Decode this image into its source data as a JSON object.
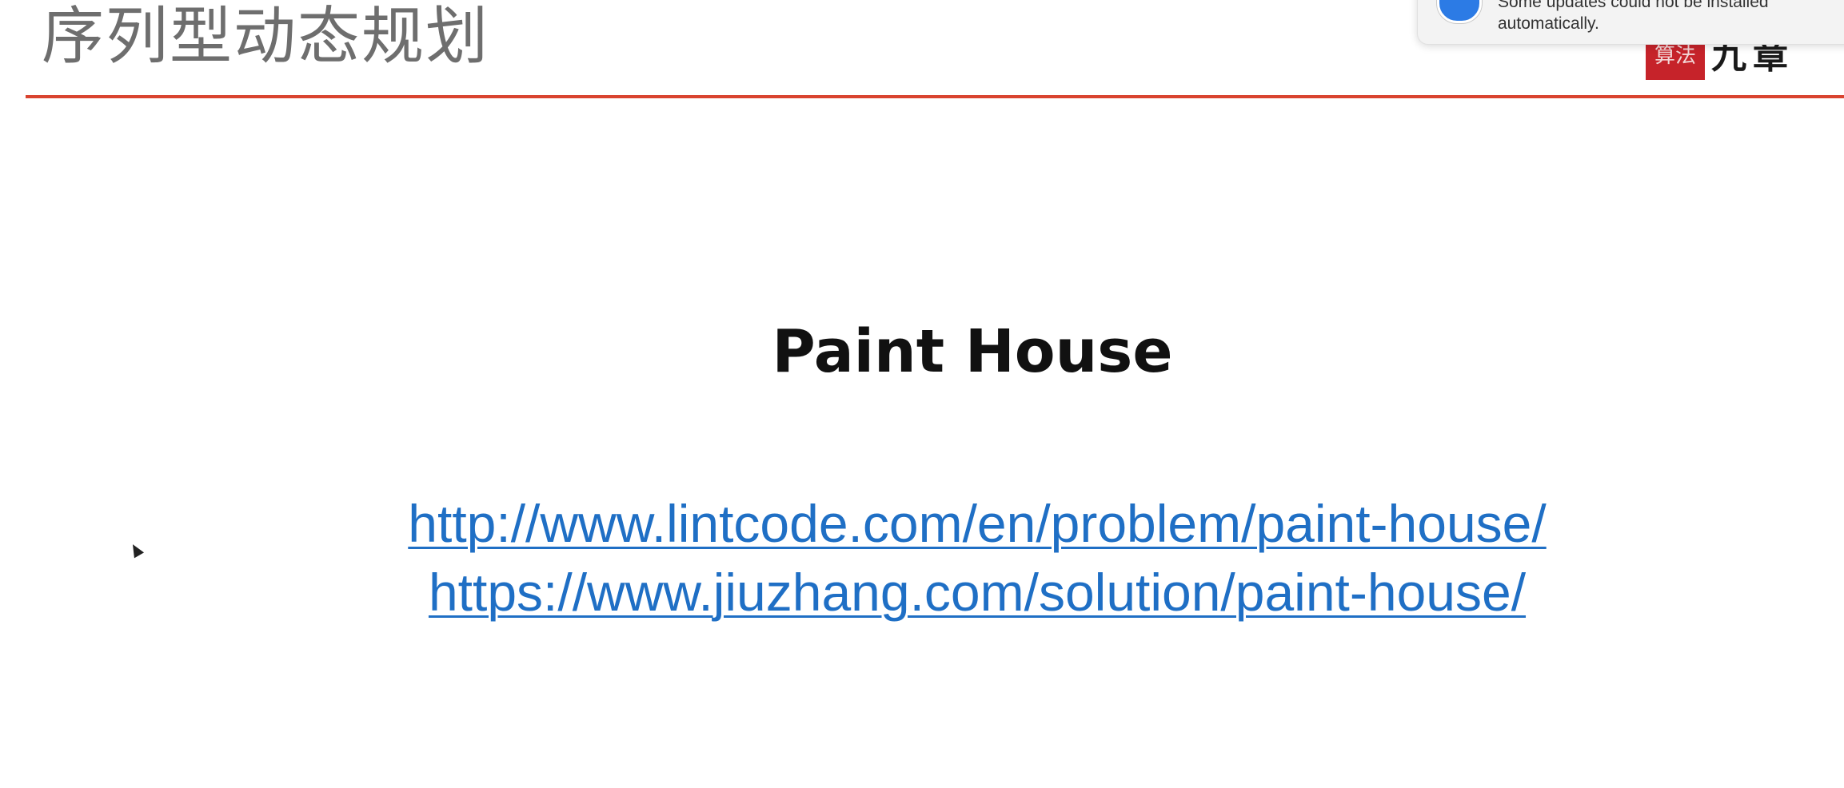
{
  "slide": {
    "title": "序列型动态规划",
    "heading": "Paint House",
    "links": [
      "http://www.lintcode.com/en/problem/paint-house/",
      "https://www.jiuzhang.com/solution/paint-house/"
    ]
  },
  "logo": {
    "seal_text": "算法",
    "calligraphy_text": "九章"
  },
  "notification": {
    "icon": "app-store-update-icon",
    "line1": "Some updates could not be installed",
    "line2": "automatically."
  },
  "colors": {
    "title_rule": "#d9432f",
    "link": "#1f6fc5",
    "seal": "#c6232a"
  }
}
